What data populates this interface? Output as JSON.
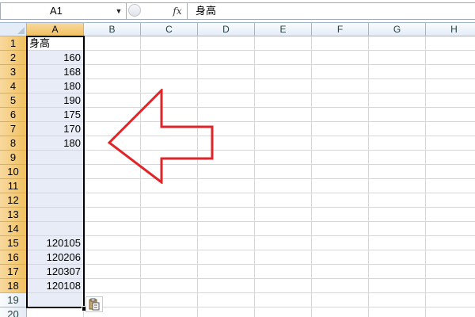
{
  "formula_bar": {
    "name_box": "A1",
    "name_box_dropdown_icon": "dropdown-arrow-icon",
    "cancel_icon": "cancel-circle-icon",
    "fx_label": "fx",
    "formula_value": "身高"
  },
  "grid": {
    "columns": [
      "A",
      "B",
      "C",
      "D",
      "E",
      "F",
      "G",
      "H"
    ],
    "selected_column": "A",
    "rows": [
      "1",
      "2",
      "3",
      "4",
      "5",
      "6",
      "7",
      "8",
      "9",
      "10",
      "11",
      "12",
      "13",
      "14",
      "15",
      "16",
      "17",
      "18",
      "19",
      "20"
    ],
    "selected_rows": [
      "1",
      "2",
      "3",
      "4",
      "5",
      "6",
      "7",
      "8",
      "9",
      "10",
      "11",
      "12",
      "13",
      "14",
      "15",
      "16",
      "17",
      "18"
    ],
    "column_a": [
      "身高",
      "160",
      "168",
      "180",
      "190",
      "175",
      "170",
      "180",
      "",
      "",
      "",
      "",
      "",
      "",
      "120105",
      "120206",
      "120307",
      "120108"
    ]
  },
  "paste_options_icon": "paste-clipboard-icon",
  "annotation": {
    "arrow_color": "#e0252a",
    "arrow_icon": "left-arrow-icon"
  },
  "colors": {
    "header_bg": "#e4ecf7",
    "selected_header": "#f1c15f",
    "selection_fill": "#e8ecf7",
    "gridline": "#d0d7e5"
  }
}
